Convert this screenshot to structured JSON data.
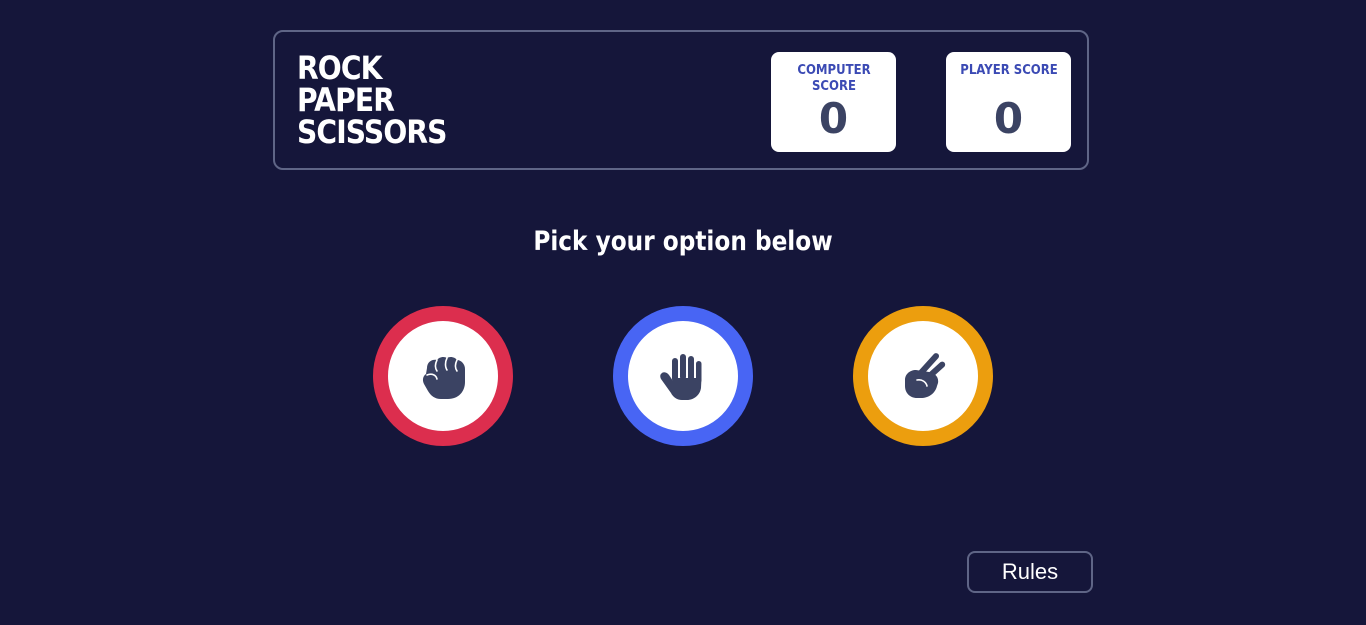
{
  "header": {
    "title_lines": [
      "ROCK",
      "PAPER",
      "SCISSORS"
    ],
    "computer_score": {
      "label": "COMPUTER SCORE",
      "value": "0"
    },
    "player_score": {
      "label": "PLAYER SCORE",
      "value": "0"
    }
  },
  "prompt": "Pick your option below",
  "options": [
    {
      "name": "rock",
      "icon": "fist-icon",
      "ring_color": "#dc2e4e"
    },
    {
      "name": "paper",
      "icon": "open-hand-icon",
      "ring_color": "#4865f4"
    },
    {
      "name": "scissors",
      "icon": "scissors-hand-icon",
      "ring_color": "#ec9e0e"
    }
  ],
  "rules_button": {
    "label": "Rules"
  },
  "colors": {
    "background": "#15163a",
    "header_border": "#5f6586",
    "score_label": "#3b4ab4",
    "score_value": "#3b4363",
    "icon": "#3b4363"
  }
}
